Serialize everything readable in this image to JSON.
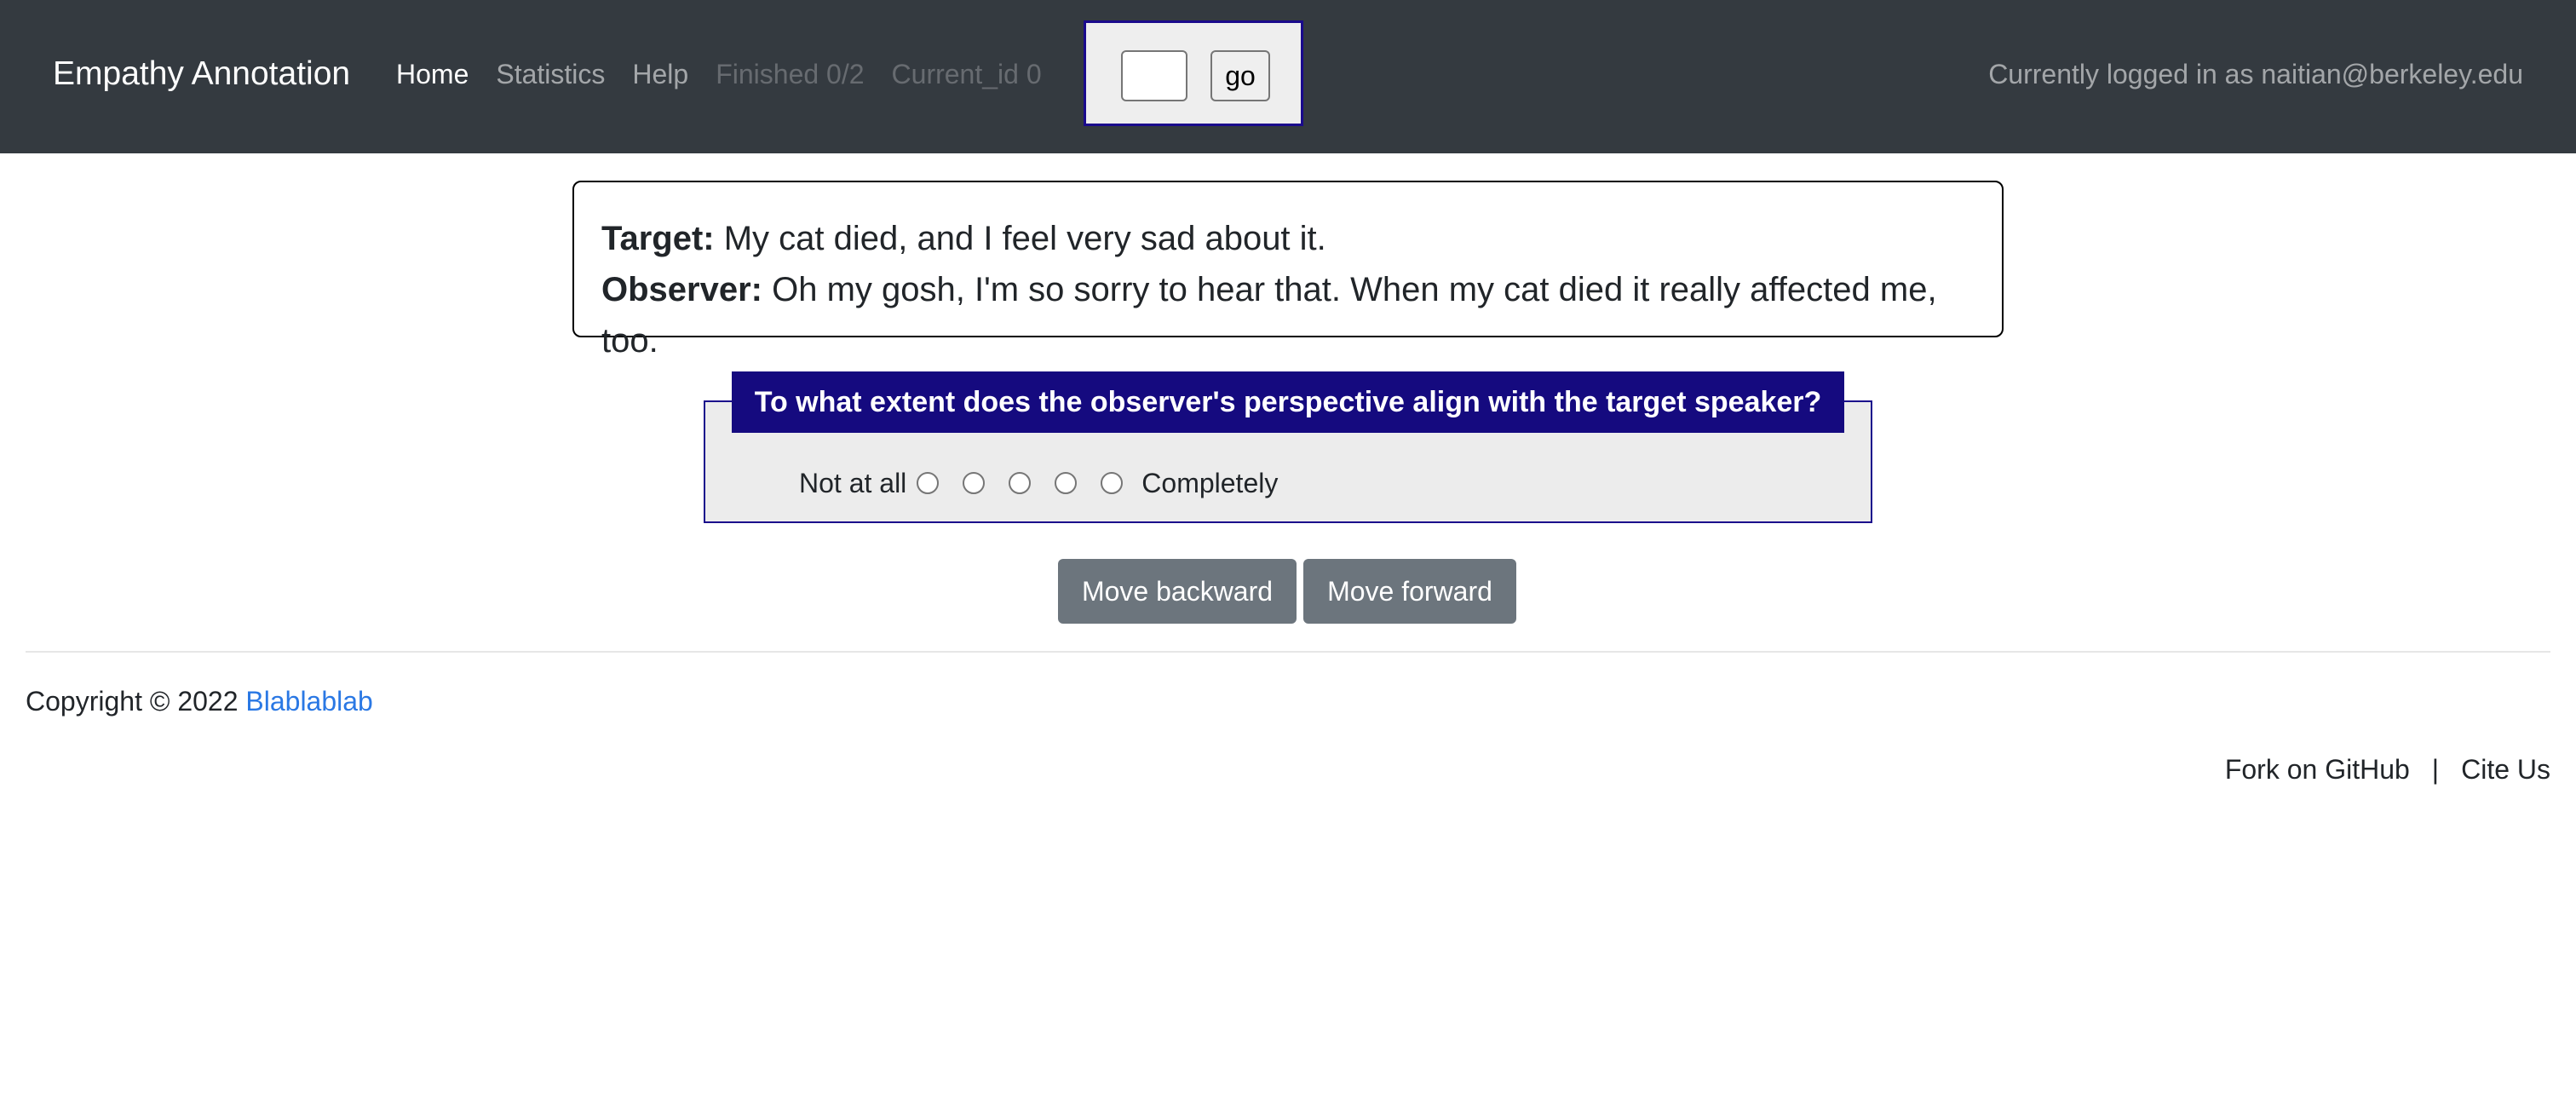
{
  "navbar": {
    "brand": "Empathy Annotation",
    "links": [
      {
        "label": "Home",
        "state": "active"
      },
      {
        "label": "Statistics",
        "state": "normal"
      },
      {
        "label": "Help",
        "state": "normal"
      },
      {
        "label": "Finished 0/2",
        "state": "disabled"
      },
      {
        "label": "Current_id 0",
        "state": "disabled"
      }
    ],
    "goto": {
      "input_value": "",
      "button_label": "go"
    },
    "login_text": "Currently logged in as naitian@berkeley.edu"
  },
  "dialogue": {
    "target_label": "Target:",
    "target_text": " My cat died, and I feel very sad about it.",
    "observer_label": "Observer:",
    "observer_text": " Oh my gosh, I'm so sorry to hear that. When my cat died it really affected me, too."
  },
  "question": {
    "prompt": "To what extent does the observer's perspective align with the target speaker?",
    "scale_low": "Not at all",
    "scale_high": "Completely",
    "options_count": 5
  },
  "buttons": {
    "backward": "Move backward",
    "forward": "Move forward"
  },
  "footer": {
    "copyright_prefix": "Copyright © 2022 ",
    "copyright_link": "Blablablab",
    "links": [
      "Fork on GitHub",
      "Cite Us"
    ],
    "separator": "|"
  },
  "colors": {
    "navbar_bg": "#343a40",
    "legend_bg": "#150a7f",
    "button_bg": "#6c757d",
    "link": "#2a78e4"
  }
}
